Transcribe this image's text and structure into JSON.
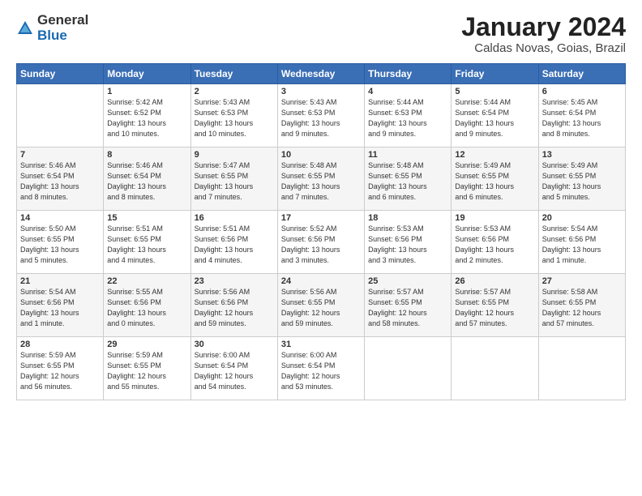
{
  "logo": {
    "general": "General",
    "blue": "Blue"
  },
  "title": "January 2024",
  "subtitle": "Caldas Novas, Goias, Brazil",
  "days_of_week": [
    "Sunday",
    "Monday",
    "Tuesday",
    "Wednesday",
    "Thursday",
    "Friday",
    "Saturday"
  ],
  "weeks": [
    [
      {
        "day": "",
        "info": ""
      },
      {
        "day": "1",
        "info": "Sunrise: 5:42 AM\nSunset: 6:52 PM\nDaylight: 13 hours\nand 10 minutes."
      },
      {
        "day": "2",
        "info": "Sunrise: 5:43 AM\nSunset: 6:53 PM\nDaylight: 13 hours\nand 10 minutes."
      },
      {
        "day": "3",
        "info": "Sunrise: 5:43 AM\nSunset: 6:53 PM\nDaylight: 13 hours\nand 9 minutes."
      },
      {
        "day": "4",
        "info": "Sunrise: 5:44 AM\nSunset: 6:53 PM\nDaylight: 13 hours\nand 9 minutes."
      },
      {
        "day": "5",
        "info": "Sunrise: 5:44 AM\nSunset: 6:54 PM\nDaylight: 13 hours\nand 9 minutes."
      },
      {
        "day": "6",
        "info": "Sunrise: 5:45 AM\nSunset: 6:54 PM\nDaylight: 13 hours\nand 8 minutes."
      }
    ],
    [
      {
        "day": "7",
        "info": "Sunrise: 5:46 AM\nSunset: 6:54 PM\nDaylight: 13 hours\nand 8 minutes."
      },
      {
        "day": "8",
        "info": "Sunrise: 5:46 AM\nSunset: 6:54 PM\nDaylight: 13 hours\nand 8 minutes."
      },
      {
        "day": "9",
        "info": "Sunrise: 5:47 AM\nSunset: 6:55 PM\nDaylight: 13 hours\nand 7 minutes."
      },
      {
        "day": "10",
        "info": "Sunrise: 5:48 AM\nSunset: 6:55 PM\nDaylight: 13 hours\nand 7 minutes."
      },
      {
        "day": "11",
        "info": "Sunrise: 5:48 AM\nSunset: 6:55 PM\nDaylight: 13 hours\nand 6 minutes."
      },
      {
        "day": "12",
        "info": "Sunrise: 5:49 AM\nSunset: 6:55 PM\nDaylight: 13 hours\nand 6 minutes."
      },
      {
        "day": "13",
        "info": "Sunrise: 5:49 AM\nSunset: 6:55 PM\nDaylight: 13 hours\nand 5 minutes."
      }
    ],
    [
      {
        "day": "14",
        "info": "Sunrise: 5:50 AM\nSunset: 6:55 PM\nDaylight: 13 hours\nand 5 minutes."
      },
      {
        "day": "15",
        "info": "Sunrise: 5:51 AM\nSunset: 6:55 PM\nDaylight: 13 hours\nand 4 minutes."
      },
      {
        "day": "16",
        "info": "Sunrise: 5:51 AM\nSunset: 6:56 PM\nDaylight: 13 hours\nand 4 minutes."
      },
      {
        "day": "17",
        "info": "Sunrise: 5:52 AM\nSunset: 6:56 PM\nDaylight: 13 hours\nand 3 minutes."
      },
      {
        "day": "18",
        "info": "Sunrise: 5:53 AM\nSunset: 6:56 PM\nDaylight: 13 hours\nand 3 minutes."
      },
      {
        "day": "19",
        "info": "Sunrise: 5:53 AM\nSunset: 6:56 PM\nDaylight: 13 hours\nand 2 minutes."
      },
      {
        "day": "20",
        "info": "Sunrise: 5:54 AM\nSunset: 6:56 PM\nDaylight: 13 hours\nand 1 minute."
      }
    ],
    [
      {
        "day": "21",
        "info": "Sunrise: 5:54 AM\nSunset: 6:56 PM\nDaylight: 13 hours\nand 1 minute."
      },
      {
        "day": "22",
        "info": "Sunrise: 5:55 AM\nSunset: 6:56 PM\nDaylight: 13 hours\nand 0 minutes."
      },
      {
        "day": "23",
        "info": "Sunrise: 5:56 AM\nSunset: 6:56 PM\nDaylight: 12 hours\nand 59 minutes."
      },
      {
        "day": "24",
        "info": "Sunrise: 5:56 AM\nSunset: 6:55 PM\nDaylight: 12 hours\nand 59 minutes."
      },
      {
        "day": "25",
        "info": "Sunrise: 5:57 AM\nSunset: 6:55 PM\nDaylight: 12 hours\nand 58 minutes."
      },
      {
        "day": "26",
        "info": "Sunrise: 5:57 AM\nSunset: 6:55 PM\nDaylight: 12 hours\nand 57 minutes."
      },
      {
        "day": "27",
        "info": "Sunrise: 5:58 AM\nSunset: 6:55 PM\nDaylight: 12 hours\nand 57 minutes."
      }
    ],
    [
      {
        "day": "28",
        "info": "Sunrise: 5:59 AM\nSunset: 6:55 PM\nDaylight: 12 hours\nand 56 minutes."
      },
      {
        "day": "29",
        "info": "Sunrise: 5:59 AM\nSunset: 6:55 PM\nDaylight: 12 hours\nand 55 minutes."
      },
      {
        "day": "30",
        "info": "Sunrise: 6:00 AM\nSunset: 6:54 PM\nDaylight: 12 hours\nand 54 minutes."
      },
      {
        "day": "31",
        "info": "Sunrise: 6:00 AM\nSunset: 6:54 PM\nDaylight: 12 hours\nand 53 minutes."
      },
      {
        "day": "",
        "info": ""
      },
      {
        "day": "",
        "info": ""
      },
      {
        "day": "",
        "info": ""
      }
    ]
  ]
}
